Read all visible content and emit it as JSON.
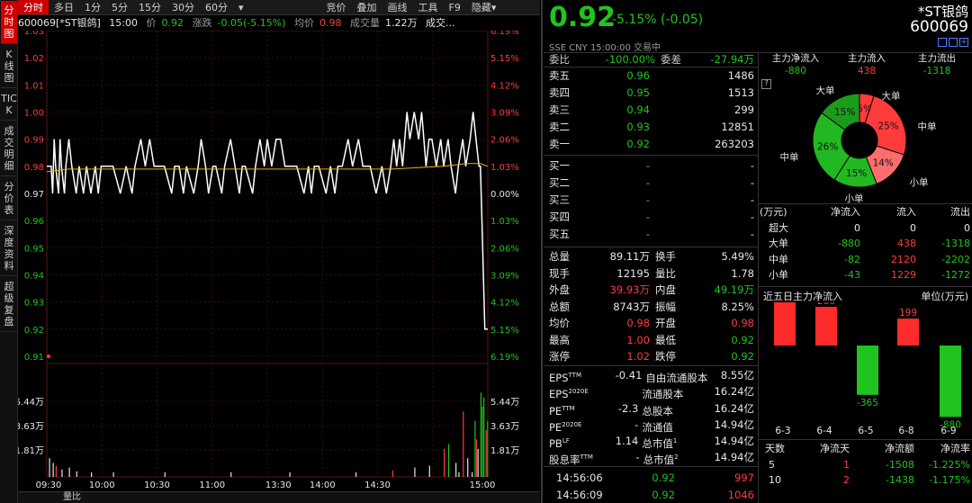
{
  "leftbar": [
    "分时图",
    "K线图",
    "TICK",
    "成交明细",
    "分价表",
    "深度资料",
    "超级复盘"
  ],
  "toptabs": [
    "分时",
    "多日",
    "1分",
    "5分",
    "15分",
    "30分",
    "60分",
    "▾",
    "竞价",
    "叠加",
    "画线",
    "工具",
    "F9",
    "隐藏▾"
  ],
  "info": {
    "code": "600069[*ST银鸽]",
    "time": "15:00",
    "price_l": "价",
    "price": "0.92",
    "chg_l": "涨跌",
    "chg": "-0.05(-5.15%)",
    "avg_l": "均价",
    "avg": "0.98",
    "vol_l": "成交量",
    "vol": "1.22万",
    "more": "成交..."
  },
  "bottom": "量比",
  "header": {
    "price": "0.92",
    "change": "-5.15% (-0.05)",
    "name": "*ST银鸽",
    "code": "600069",
    "meta": "SSE  CNY  15:00:00  交易中"
  },
  "weibi": {
    "l1": "委比",
    "v1": "-100.00%",
    "l2": "委差",
    "v2": "-27.94万"
  },
  "sells": [
    {
      "label": "卖五",
      "price": "0.96",
      "vol": "1486"
    },
    {
      "label": "卖四",
      "price": "0.95",
      "vol": "1513"
    },
    {
      "label": "卖三",
      "price": "0.94",
      "vol": "299"
    },
    {
      "label": "卖二",
      "price": "0.93",
      "vol": "12851"
    },
    {
      "label": "卖一",
      "price": "0.92",
      "vol": "263203"
    }
  ],
  "buys": [
    {
      "label": "买一",
      "price": "-",
      "vol": "-"
    },
    {
      "label": "买二",
      "price": "-",
      "vol": "-"
    },
    {
      "label": "买三",
      "price": "-",
      "vol": "-"
    },
    {
      "label": "买四",
      "price": "-",
      "vol": "-"
    },
    {
      "label": "买五",
      "price": "-",
      "vol": "-"
    }
  ],
  "stats": [
    {
      "l1": "总量",
      "v1": "89.11万",
      "c1": "w",
      "l2": "换手",
      "v2": "5.49%",
      "c2": "w"
    },
    {
      "l1": "现手",
      "v1": "12195",
      "c1": "w",
      "l2": "量比",
      "v2": "1.78",
      "c2": "w"
    },
    {
      "l1": "外盘",
      "v1": "39.93万",
      "c1": "r",
      "l2": "内盘",
      "v2": "49.19万",
      "c2": "g"
    },
    {
      "l1": "总额",
      "v1": "8743万",
      "c1": "w",
      "l2": "振幅",
      "v2": "8.25%",
      "c2": "w"
    },
    {
      "l1": "均价",
      "v1": "0.98",
      "c1": "r",
      "l2": "开盘",
      "v2": "0.98",
      "c2": "r"
    },
    {
      "l1": "最高",
      "v1": "1.00",
      "c1": "r",
      "l2": "最低",
      "v2": "0.92",
      "c2": "g"
    },
    {
      "l1": "涨停",
      "v1": "1.02",
      "c1": "r",
      "l2": "跌停",
      "v2": "0.92",
      "c2": "g"
    }
  ],
  "fund": [
    {
      "l1": "EPS",
      "s1": "TTM",
      "v1": "-0.41",
      "l2": "自由流通股本",
      "s2": "",
      "v2": "8.55亿"
    },
    {
      "l1": "EPS",
      "s1": "2020E",
      "v1": "",
      "l2": "流通股本",
      "s2": "",
      "v2": "16.24亿"
    },
    {
      "l1": "PE",
      "s1": "TTM",
      "v1": "-2.3",
      "l2": "总股本",
      "s2": "",
      "v2": "16.24亿"
    },
    {
      "l1": "PE",
      "s1": "2020E",
      "v1": "-",
      "l2": "流通值",
      "s2": "",
      "v2": "14.94亿"
    },
    {
      "l1": "PB",
      "s1": "LF",
      "v1": "1.14",
      "l2": "总市值",
      "s2": "1",
      "v2": "14.94亿"
    },
    {
      "l1": "股息率",
      "s1": "TTM",
      "v1": "-",
      "l2": "总市值",
      "s2": "2",
      "v2": "14.94亿"
    }
  ],
  "ticks": [
    {
      "time": "14:56:06",
      "price": "0.92",
      "vol": "997"
    },
    {
      "time": "14:56:09",
      "price": "0.92",
      "vol": "1046"
    }
  ],
  "flow": {
    "headers": [
      "主力净流入",
      "主力流入",
      "主力流出"
    ],
    "values": [
      "-880",
      "438",
      "-1318"
    ],
    "help": "?",
    "pie_labels": {
      "big_l": "大单",
      "big_r": "大单",
      "mid_r": "中单",
      "mid_l": "中单",
      "small_r": "小单",
      "small_b": "小单"
    },
    "pie": [
      {
        "name": "大单",
        "side": "in",
        "pct": 5,
        "label": "5%",
        "color": "#ff3b3b"
      },
      {
        "name": "中单",
        "side": "in",
        "pct": 25,
        "label": "25%",
        "color": "#ff3b3b"
      },
      {
        "name": "小单",
        "side": "in",
        "pct": 14,
        "label": "14%",
        "color": "#ff6e6e"
      },
      {
        "name": "小单",
        "side": "out",
        "pct": 15,
        "label": "15%",
        "color": "#22b822"
      },
      {
        "name": "中单",
        "side": "out",
        "pct": 26,
        "label": "26%",
        "color": "#22b822"
      },
      {
        "name": "大单",
        "side": "out",
        "pct": 15,
        "label": "15%",
        "color": "#1a9c1a"
      }
    ],
    "table_head": [
      "(万元)",
      "净流入",
      "流入",
      "流出"
    ],
    "table": [
      {
        "name": "超大",
        "net": "0",
        "in": "0",
        "out": "0"
      },
      {
        "name": "大单",
        "net": "-880",
        "in": "438",
        "out": "-1318"
      },
      {
        "name": "中单",
        "net": "-82",
        "in": "2120",
        "out": "-2202"
      },
      {
        "name": "小单",
        "net": "-43",
        "in": "1229",
        "out": "-1272"
      }
    ],
    "five_title": "近五日主力净流入",
    "five_unit": "单位(万元)",
    "five_days": {
      "days": [
        "6-3",
        "6-4",
        "6-5",
        "6-8",
        "6-9"
      ],
      "values": [
        426,
        286,
        -365,
        199,
        -880
      ]
    },
    "hist_head": [
      "天数",
      "净流天",
      "净流额",
      "净流率"
    ],
    "hist": [
      {
        "d": "5",
        "n": "1",
        "amt": "-1508",
        "rate": "-1.225%"
      },
      {
        "d": "10",
        "n": "2",
        "amt": "-1438",
        "rate": "-1.175%"
      }
    ]
  },
  "chart_data": {
    "type": "line",
    "prev_close": 0.97,
    "price_ticks": [
      "1.03",
      "1.02",
      "1.01",
      "1.00",
      "0.99",
      "0.98",
      "0.97",
      "0.96",
      "0.95",
      "0.94",
      "0.93",
      "0.92",
      "0.91"
    ],
    "pct_ticks": [
      "6.19%",
      "5.15%",
      "4.12%",
      "3.09%",
      "2.06%",
      "1.03%",
      "0.00%",
      "1.03%",
      "2.06%",
      "3.09%",
      "4.12%",
      "5.15%",
      "6.19%"
    ],
    "vol_ticks": [
      "5.44万",
      "3.63万",
      "1.81万"
    ],
    "time_labels": [
      "09:30",
      "10:00",
      "10:30",
      "11:00",
      "13:30",
      "14:00",
      "14:30",
      "15:00"
    ],
    "ylim": [
      0.91,
      1.03
    ],
    "price_path": [
      [
        0,
        0.98
      ],
      [
        6,
        0.98
      ],
      [
        8,
        0.97
      ],
      [
        10,
        0.99
      ],
      [
        12,
        0.98
      ],
      [
        16,
        0.97
      ],
      [
        18,
        0.99
      ],
      [
        20,
        0.98
      ],
      [
        24,
        0.97
      ],
      [
        26,
        0.98
      ],
      [
        30,
        0.99
      ],
      [
        34,
        0.98
      ],
      [
        40,
        0.97
      ],
      [
        44,
        0.98
      ],
      [
        50,
        0.97
      ],
      [
        54,
        0.98
      ],
      [
        60,
        0.97
      ],
      [
        66,
        0.98
      ],
      [
        70,
        0.97
      ],
      [
        74,
        0.98
      ],
      [
        80,
        0.98
      ],
      [
        90,
        0.98
      ],
      [
        100,
        0.97
      ],
      [
        108,
        0.98
      ],
      [
        116,
        0.97
      ],
      [
        120,
        0.98
      ],
      [
        128,
        0.99
      ],
      [
        134,
        0.98
      ],
      [
        140,
        0.99
      ],
      [
        146,
        0.98
      ],
      [
        160,
        0.98
      ],
      [
        170,
        0.97
      ],
      [
        174,
        0.98
      ],
      [
        180,
        0.98
      ],
      [
        186,
        0.97
      ],
      [
        190,
        0.98
      ],
      [
        200,
        0.97
      ],
      [
        206,
        0.98
      ],
      [
        210,
        0.99
      ],
      [
        216,
        0.98
      ],
      [
        220,
        0.97
      ],
      [
        226,
        0.98
      ],
      [
        230,
        0.98
      ],
      [
        238,
        0.97
      ],
      [
        242,
        0.98
      ],
      [
        250,
        0.99
      ],
      [
        256,
        0.98
      ],
      [
        262,
        0.97
      ],
      [
        266,
        0.98
      ],
      [
        270,
        0.98
      ],
      [
        280,
        0.97
      ],
      [
        284,
        0.98
      ],
      [
        290,
        0.99
      ],
      [
        296,
        0.98
      ],
      [
        300,
        0.99
      ],
      [
        306,
        0.98
      ],
      [
        312,
        0.99
      ],
      [
        318,
        0.99
      ],
      [
        324,
        0.98
      ],
      [
        330,
        0.98
      ],
      [
        340,
        0.98
      ],
      [
        350,
        0.97
      ],
      [
        356,
        0.98
      ],
      [
        360,
        0.97
      ],
      [
        364,
        0.98
      ],
      [
        370,
        0.98
      ],
      [
        380,
        0.97
      ],
      [
        386,
        0.98
      ],
      [
        392,
        0.97
      ],
      [
        396,
        0.98
      ],
      [
        402,
        0.98
      ],
      [
        410,
        0.99
      ],
      [
        416,
        0.98
      ],
      [
        424,
        0.99
      ],
      [
        430,
        0.98
      ],
      [
        440,
        0.98
      ],
      [
        448,
        0.97
      ],
      [
        456,
        0.98
      ],
      [
        462,
        0.97
      ],
      [
        468,
        0.98
      ],
      [
        472,
        0.99
      ],
      [
        476,
        0.98
      ],
      [
        480,
        0.99
      ],
      [
        484,
        0.98
      ],
      [
        490,
        1.0
      ],
      [
        494,
        0.99
      ],
      [
        500,
        1.0
      ],
      [
        506,
        0.99
      ],
      [
        510,
        1.0
      ],
      [
        516,
        0.98
      ],
      [
        520,
        0.99
      ],
      [
        524,
        0.99
      ],
      [
        530,
        0.98
      ],
      [
        536,
        0.99
      ],
      [
        540,
        0.98
      ],
      [
        546,
        0.99
      ],
      [
        550,
        0.98
      ],
      [
        556,
        0.97
      ],
      [
        560,
        0.98
      ],
      [
        566,
        0.99
      ],
      [
        570,
        0.98
      ],
      [
        576,
        0.99
      ],
      [
        580,
        1.0
      ],
      [
        584,
        0.99
      ],
      [
        588,
        0.98
      ],
      [
        590,
        0.98
      ],
      [
        592,
        0.96
      ],
      [
        594,
        0.94
      ],
      [
        596,
        0.92
      ],
      [
        600,
        0.92
      ]
    ],
    "avg_path": [
      [
        0,
        0.978
      ],
      [
        30,
        0.979
      ],
      [
        80,
        0.979
      ],
      [
        160,
        0.979
      ],
      [
        240,
        0.979
      ],
      [
        320,
        0.979
      ],
      [
        400,
        0.979
      ],
      [
        470,
        0.979
      ],
      [
        540,
        0.98
      ],
      [
        570,
        0.981
      ],
      [
        590,
        0.981
      ],
      [
        600,
        0.98
      ]
    ],
    "vol_bars": [
      [
        3,
        0.2
      ],
      [
        8,
        0.15
      ],
      [
        12,
        0.12
      ],
      [
        20,
        0.08
      ],
      [
        30,
        0.1
      ],
      [
        40,
        0.06
      ],
      [
        60,
        0.05
      ],
      [
        90,
        0.05
      ],
      [
        160,
        0.05
      ],
      [
        250,
        0.05
      ],
      [
        330,
        0.05
      ],
      [
        420,
        0.05
      ],
      [
        470,
        0.07
      ],
      [
        500,
        0.1
      ],
      [
        520,
        0.12
      ],
      [
        540,
        0.3
      ],
      [
        546,
        0.35
      ],
      [
        556,
        0.15
      ],
      [
        560,
        0.05
      ],
      [
        566,
        0.7
      ],
      [
        572,
        0.2
      ],
      [
        578,
        0.05
      ],
      [
        582,
        0.6
      ],
      [
        584,
        0.4
      ],
      [
        586,
        0.3
      ],
      [
        590,
        0.9
      ],
      [
        592,
        0.75
      ],
      [
        594,
        0.85
      ],
      [
        597,
        0.5
      ],
      [
        599,
        0.6
      ]
    ],
    "vol_colors": [
      "w",
      "w",
      "r",
      "w",
      "w",
      "w",
      "w",
      "w",
      "w",
      "w",
      "w",
      "w",
      "r",
      "w",
      "w",
      "r",
      "g",
      "w",
      "w",
      "r",
      "w",
      "w",
      "g",
      "r",
      "w",
      "g",
      "g",
      "g",
      "r",
      "g"
    ]
  }
}
